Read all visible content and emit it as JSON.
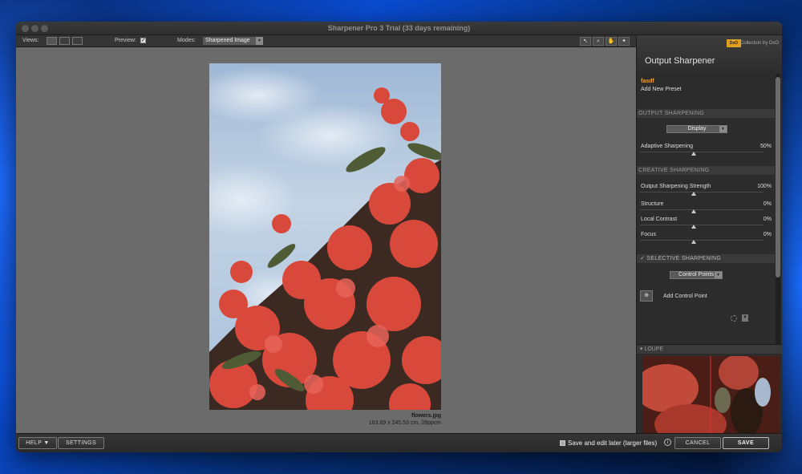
{
  "window": {
    "title": "Sharpener Pro 3 Trial (33 days remaining)"
  },
  "toolbar": {
    "views_label": "Views:",
    "preview_label": "Preview:",
    "preview_checked": "✓",
    "modes_label": "Modes:",
    "mode_value": "Sharpened Image",
    "mode_arrow": "▾",
    "tools": [
      {
        "icon": "pointer-icon",
        "glyph": "↖"
      },
      {
        "icon": "zoom-icon",
        "glyph": "⌕"
      },
      {
        "icon": "hand-icon",
        "glyph": "✋"
      },
      {
        "icon": "info-tool-icon",
        "glyph": "✦"
      }
    ]
  },
  "image": {
    "filename": "flowers.jpg",
    "dimensions": "163.69 x 245.53 cm, 28ppcm"
  },
  "panel": {
    "title": "Output Sharpener",
    "badge": "DxO",
    "collection": "Collection by DxO",
    "preset_name": "fasdf",
    "add_preset": "Add New Preset",
    "output_sharpening": {
      "header": "OUTPUT SHARPENING",
      "dropdown": "Display",
      "adaptive_label": "Adaptive Sharpening",
      "adaptive_value": "50%"
    },
    "creative_sharpening": {
      "header": "CREATIVE SHARPENING",
      "rows": [
        {
          "label": "Output Sharpening Strength",
          "value": "100%"
        },
        {
          "label": "Structure",
          "value": "0%"
        },
        {
          "label": "Local Contrast",
          "value": "0%"
        },
        {
          "label": "Focus",
          "value": "0%"
        }
      ]
    },
    "selective_sharpening": {
      "header": "✓  SELECTIVE SHARPENING",
      "dropdown": "Control Points",
      "add_cp": "Add Control Point"
    },
    "loupe": {
      "header": "▾ LOUPE"
    }
  },
  "footer": {
    "help": "HELP ▼",
    "settings": "SETTINGS",
    "save_later": "Save and edit later (larger files)",
    "info": "i",
    "cancel": "CANCEL",
    "save": "SAVE"
  },
  "colors": {
    "accent_orange": "#f0a030",
    "canvas_gray": "#6b6b6b",
    "panel_dark": "#2c2c2c"
  }
}
